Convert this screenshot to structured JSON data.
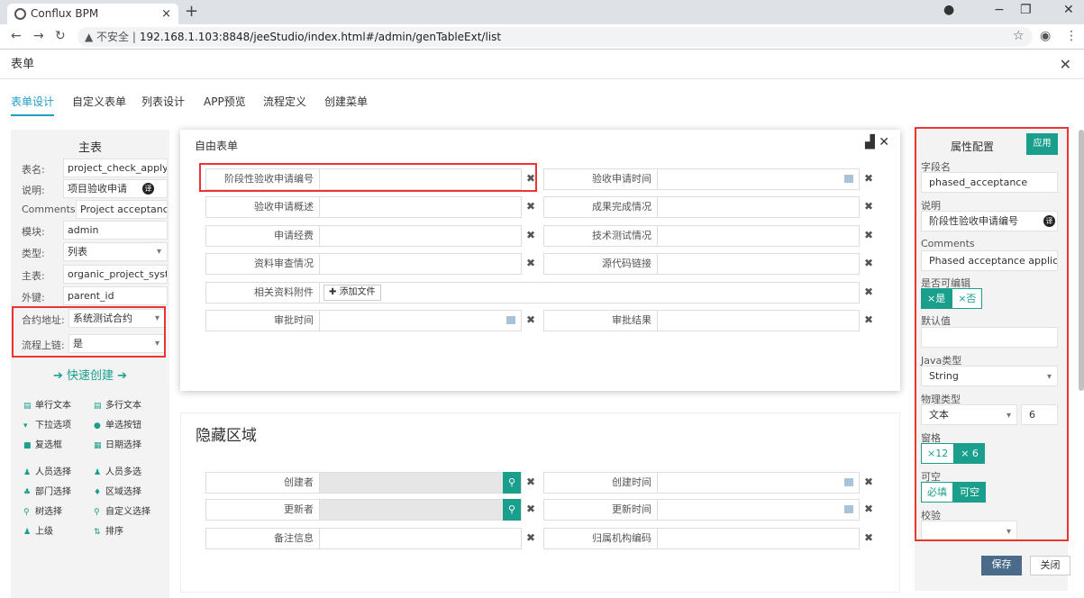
{
  "browser": {
    "tab_title": "Conflux BPM",
    "new_tab": "+",
    "tab_close": "×",
    "security": "▲ 不安全 |",
    "url": "192.168.1.103:8848/jeeStudio/index.html#/admin/genTableExt/list"
  },
  "app": {
    "title": "表单",
    "tabs": [
      "表单设计",
      "自定义表单",
      "列表设计",
      "APP预览",
      "流程定义",
      "创建菜单"
    ]
  },
  "left": {
    "title": "主表",
    "rows": [
      {
        "label": "表名:",
        "value": "project_check_apply"
      },
      {
        "label": "说明:",
        "value": "项目验收申请"
      },
      {
        "label": "Comments:",
        "value": "Project acceptance"
      },
      {
        "label": "模块:",
        "value": "admin"
      },
      {
        "label": "类型:",
        "value": "列表"
      },
      {
        "label": "主表:",
        "value": "organic_project_system"
      },
      {
        "label": "外键:",
        "value": "parent_id"
      },
      {
        "label": "合约地址:",
        "value": "系统测试合约"
      },
      {
        "label": "流程上链:",
        "value": "是"
      }
    ],
    "quick_create": "快速创建",
    "components": [
      [
        "单行文本",
        "多行文本"
      ],
      [
        "下拉选项",
        "单选按钮"
      ],
      [
        "复选框",
        "日期选择"
      ],
      [
        "人员选择",
        "人员多选"
      ],
      [
        "部门选择",
        "区域选择"
      ],
      [
        "树选择",
        "自定义选择"
      ],
      [
        "上级",
        "排序"
      ]
    ]
  },
  "modal": {
    "title": "自由表单",
    "fields": [
      "阶段性验收申请编号",
      "验收申请时间",
      "验收申请概述",
      "成果完成情况",
      "申请经费",
      "技术测试情况",
      "资料审查情况",
      "源代码链接",
      "相关资料附件",
      "审批时间",
      "审批结果"
    ],
    "add_file": "添加文件"
  },
  "hidden": {
    "title": "隐藏区域",
    "fields": [
      "创建者",
      "创建时间",
      "更新者",
      "更新时间",
      "备注信息",
      "归属机构编码"
    ]
  },
  "props": {
    "title": "属性配置",
    "apply": "应用",
    "field_name_label": "字段名",
    "field_name": "phased_acceptance",
    "desc_label": "说明",
    "desc": "阶段性验收申请编号",
    "comments_label": "Comments",
    "comments": "Phased acceptance applicatio",
    "editable_label": "是否可编辑",
    "yes": "×是",
    "no": "×否",
    "default_label": "默认值",
    "java_label": "Java类型",
    "java": "String",
    "phys_label": "物理类型",
    "phys": "文本",
    "phys_len": "6",
    "grid_label": "窗格",
    "grid12": "×12",
    "grid6": "× 6",
    "nullable_label": "可空",
    "required": "必填",
    "nullable": "可空",
    "verify_label": "校验"
  },
  "footer": {
    "save": "保存",
    "close": "关闭"
  },
  "colors": {
    "accent": "#1a9f8c",
    "tab_active": "#1e9fc8",
    "highlight": "#e33333"
  }
}
